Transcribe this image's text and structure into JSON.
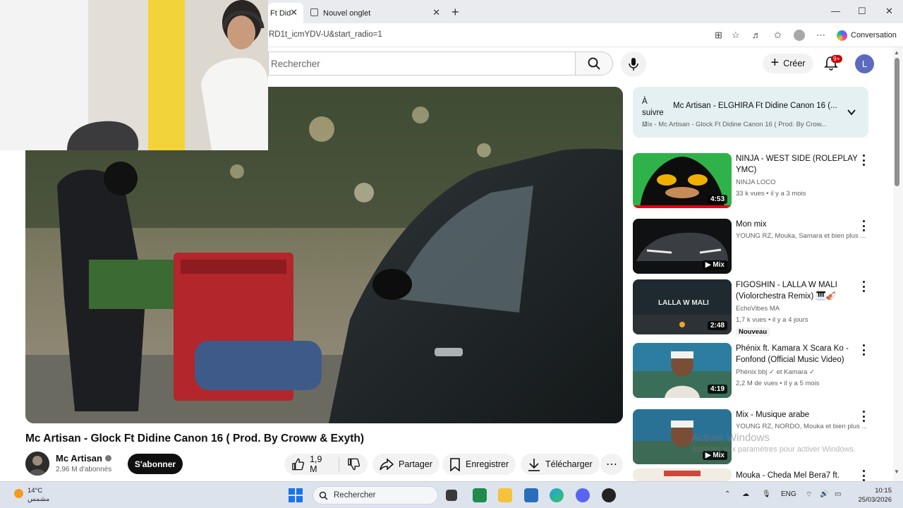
{
  "browser": {
    "tabs": [
      {
        "label": "Ft Did",
        "active": true
      },
      {
        "label": "Nouvel onglet",
        "active": false
      }
    ],
    "new_tab_symbol": "+",
    "url": "RD1t_icmYDV-U&start_radio=1",
    "conversation_label": "Conversation",
    "window_controls": [
      "minimize-icon",
      "maximize-icon",
      "close-icon"
    ]
  },
  "youtube": {
    "search_placeholder": "Rechercher",
    "create_label": "Créer",
    "notifications_badge": "9+",
    "avatar_letter": "L"
  },
  "video": {
    "title": "Mc Artisan - Glock Ft Didine Canon 16 ( Prod. By Croww & Exyth)",
    "channel": "Mc Artisan",
    "subscribers": "2,96 M d'abonnés",
    "subscribe_label": "S'abonner",
    "likes": "1,9 M",
    "share_label": "Partager",
    "save_label": "Enregistrer",
    "download_label": "Télécharger"
  },
  "up_next": {
    "label": "À suivre ::",
    "title": "Mc Artisan - ELGHIRA Ft Didine Canon 16 (...",
    "subtitle": "Mix - Mc Artisan - Glock Ft Didine Canon 16 ( Prod. By Crow..."
  },
  "recommendations": [
    {
      "title": "NINJA - WEST SIDE (ROLEPLAY YMC)",
      "channel": "NINJA LOCO",
      "meta": "33 k vues • il y a 3 mois",
      "duration": "4:53"
    },
    {
      "title": "Mon mix",
      "channel": "YOUNG RZ, Mouka, Samara et bien plus ...",
      "meta": "",
      "duration": "Mix"
    },
    {
      "title": "FIGOSHIN - LALLA W MALI (Violorchestra Remix) 🎹🎻",
      "channel": "EchoVibes MA",
      "meta": "1,7 k vues • il y a 4 jours",
      "badge": "Nouveau",
      "duration": "2:48",
      "thumb_text": "LALLA W MALI"
    },
    {
      "title": "Phénix ft. Kamara X Scara Ko - Fonfond (Official Music Video)",
      "channel": "Phénix bbj ✓ et Kamara ✓",
      "meta": "2,2 M de vues • il y a 5 mois",
      "duration": "4:19"
    },
    {
      "title": "Mix - Musique arabe",
      "channel": "YOUNG RZ, NORDO, Mouka et bien plus ...",
      "meta": "",
      "duration": "Mix"
    },
    {
      "title": "Mouka - Cheda Mel Bera7 ft.",
      "channel": "",
      "meta": "",
      "duration": ""
    }
  ],
  "watermark": {
    "line1": "Activer Windows",
    "line2": "Accédez aux paramètres pour activer Windows."
  },
  "taskbar": {
    "temperature": "14°C",
    "weather_text": "مشمس",
    "search_label": "Rechercher",
    "language": "ENG",
    "time": "10:15",
    "date": "25/03/2026"
  },
  "colors": {
    "up_next_bg": "#e4f0f2",
    "subscribe_bg": "#0f0f0f",
    "notification_badge": "#cc0000",
    "avatar_bg": "#5c6bc0",
    "taskbar_bg": "#dde3ec"
  }
}
